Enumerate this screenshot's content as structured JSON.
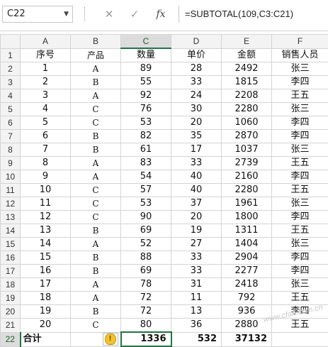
{
  "formula_bar": {
    "name_box": "C22",
    "cancel_icon": "close-icon",
    "enter_icon": "check-icon",
    "fx_label": "fx",
    "formula": "=SUBTOTAL(109,C3:C21)"
  },
  "grid": {
    "columns": [
      "A",
      "B",
      "C",
      "D",
      "E",
      "F"
    ],
    "selected_column": "C",
    "selected_row": "22",
    "header_row": [
      "序号",
      "产品",
      "数量",
      "单价",
      "金额",
      "销售人员"
    ],
    "rows": [
      [
        "1",
        "A",
        "89",
        "28",
        "2492",
        "张三"
      ],
      [
        "2",
        "B",
        "55",
        "33",
        "1815",
        "李四"
      ],
      [
        "3",
        "A",
        "92",
        "24",
        "2208",
        "王五"
      ],
      [
        "4",
        "C",
        "76",
        "30",
        "2280",
        "张三"
      ],
      [
        "5",
        "C",
        "53",
        "20",
        "1060",
        "李四"
      ],
      [
        "6",
        "B",
        "82",
        "35",
        "2870",
        "李四"
      ],
      [
        "7",
        "B",
        "61",
        "17",
        "1037",
        "张三"
      ],
      [
        "8",
        "A",
        "83",
        "33",
        "2739",
        "王五"
      ],
      [
        "9",
        "A",
        "54",
        "40",
        "2160",
        "李四"
      ],
      [
        "10",
        "C",
        "57",
        "40",
        "2280",
        "王五"
      ],
      [
        "11",
        "C",
        "53",
        "37",
        "1961",
        "张三"
      ],
      [
        "12",
        "C",
        "90",
        "20",
        "1800",
        "李四"
      ],
      [
        "13",
        "B",
        "69",
        "19",
        "1311",
        "王五"
      ],
      [
        "14",
        "A",
        "52",
        "27",
        "1404",
        "张三"
      ],
      [
        "15",
        "B",
        "88",
        "33",
        "2904",
        "李四"
      ],
      [
        "16",
        "B",
        "69",
        "33",
        "2277",
        "李四"
      ],
      [
        "17",
        "A",
        "78",
        "31",
        "2418",
        "张三"
      ],
      [
        "18",
        "A",
        "72",
        "11",
        "792",
        "王五"
      ],
      [
        "19",
        "B",
        "72",
        "13",
        "936",
        "李四"
      ],
      [
        "20",
        "C",
        "80",
        "36",
        "2880",
        "王五"
      ]
    ],
    "total_row": {
      "label": "合计",
      "warning_icon": "!",
      "quantity_total": "1336",
      "price_total": "532",
      "amount_total": "37132"
    }
  }
}
